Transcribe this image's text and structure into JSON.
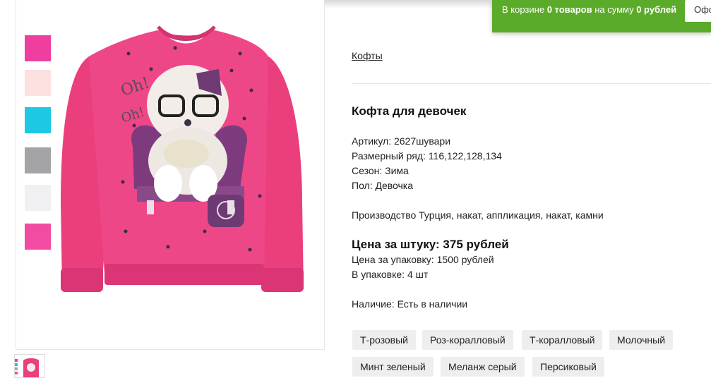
{
  "cart": {
    "prefix": "В корзине ",
    "count": "0 товаров",
    "middle": " на сумму ",
    "sum": "0 рублей",
    "button_label": "Офо"
  },
  "breadcrumb": "Кофты",
  "product": {
    "title": "Кофта для девочек",
    "article": "Артикул: 2627шувари",
    "sizes": "Размерный ряд: 116,122,128,134",
    "season": "Сезон: Зима",
    "gender": "Пол: Девочка",
    "production": "Производство Турция, накат, аппликация, накат, камни",
    "price_unit": "Цена за штуку: 375 рублей",
    "price_pack": "Цена за упаковку: 1500 рублей",
    "pack_count": "В упаковке: 4 шт",
    "availability": "Наличие: Есть в наличии"
  },
  "swatches": [
    "#ee3ea0",
    "#fde0e0",
    "#1cc8e3",
    "#a4a4a6",
    "#f0f0f2",
    "#f14ba2"
  ],
  "colors": [
    "Т-розовый",
    "Роз-коралловый",
    "Т-коралловый",
    "Молочный",
    "Минт зеленый",
    "Меланж серый",
    "Персиковый"
  ],
  "image": {
    "garment_color": "#ea3f7c",
    "alt": ""
  }
}
